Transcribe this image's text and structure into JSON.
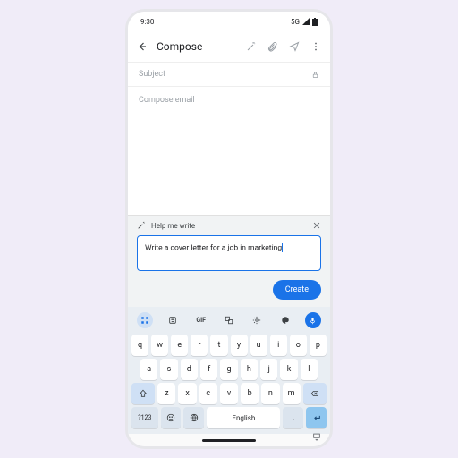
{
  "status": {
    "time": "9:30",
    "network": "5G"
  },
  "header": {
    "title": "Compose"
  },
  "compose": {
    "subject_placeholder": "Subject",
    "body_placeholder": "Compose email"
  },
  "help": {
    "title": "Help me write",
    "prompt_value": "Write a cover letter for a job in marketing",
    "create_label": "Create"
  },
  "keyboard": {
    "gif_label": "GIF",
    "row1": [
      "q",
      "w",
      "e",
      "r",
      "t",
      "y",
      "u",
      "i",
      "o",
      "p"
    ],
    "row2": [
      "a",
      "s",
      "d",
      "f",
      "g",
      "h",
      "j",
      "k",
      "l"
    ],
    "row3": [
      "z",
      "x",
      "c",
      "v",
      "b",
      "n",
      "m"
    ],
    "sym_label": "?123",
    "space_label": "English",
    "comma": ",",
    "period": "."
  }
}
